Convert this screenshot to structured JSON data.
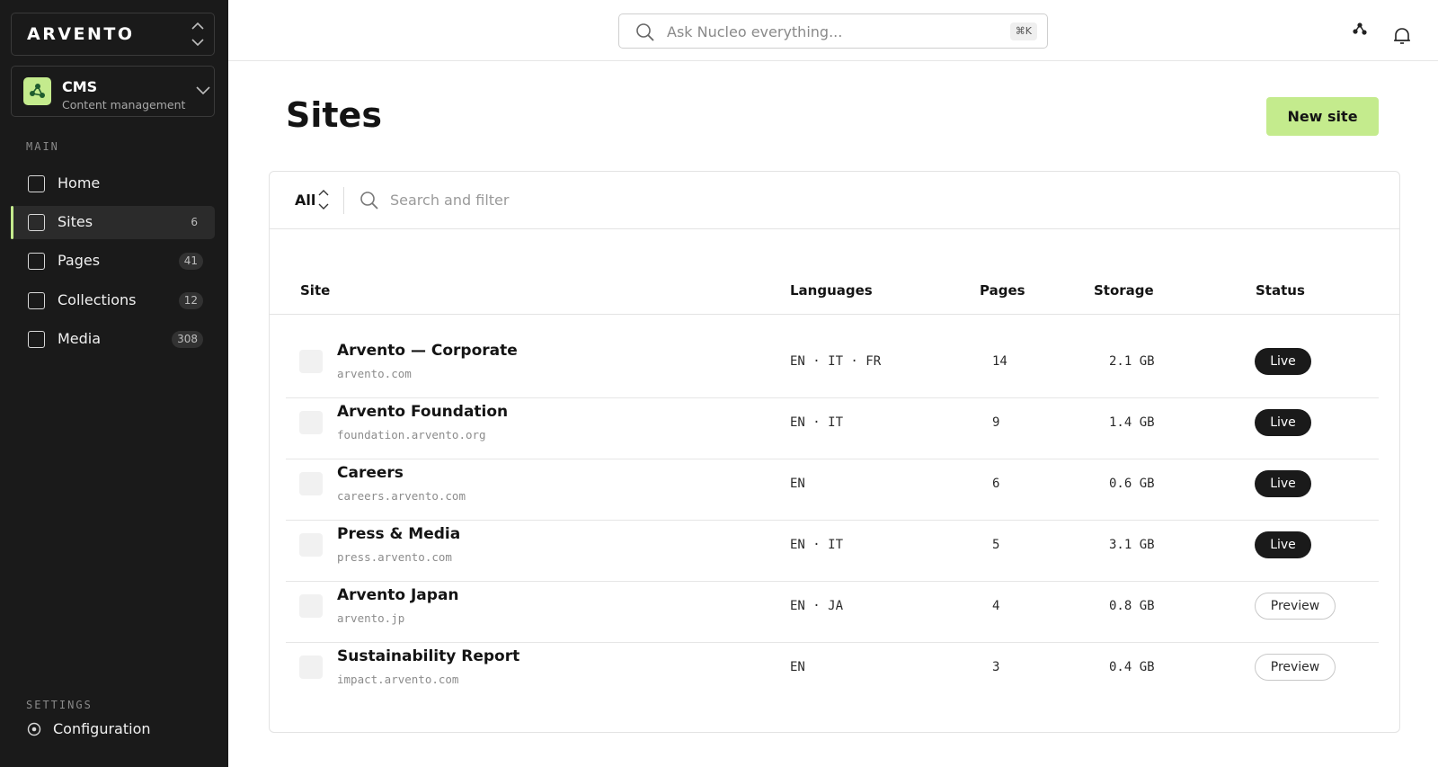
{
  "brand": {
    "name": "ARVENTO"
  },
  "workspace": {
    "title": "CMS",
    "subtitle": "Content management",
    "accent": "#c4eb8d"
  },
  "sidebar": {
    "section_main": "MAIN",
    "items": [
      {
        "label": "Home",
        "count": null
      },
      {
        "label": "Sites",
        "count": "6"
      },
      {
        "label": "Pages",
        "count": "41"
      },
      {
        "label": "Collections",
        "count": "12"
      },
      {
        "label": "Media",
        "count": "308"
      }
    ],
    "active_item": "Sites",
    "section_settings": "SETTINGS",
    "config_label": "Configuration"
  },
  "topbar": {
    "search_placeholder": "Ask Nucleo everything...",
    "search_shortcut": "⌘K",
    "icons": [
      "integrations-icon",
      "bell-icon"
    ]
  },
  "main": {
    "title": "Sites",
    "new_button": "New site",
    "filter": {
      "selected": "All",
      "search_placeholder": "Search and filter"
    },
    "columns": [
      "Site",
      "Languages",
      "Pages",
      "Storage",
      "Status"
    ],
    "rows": [
      {
        "name": "Arvento — Corporate",
        "domain": "arvento.com",
        "languages": "EN · IT · FR",
        "pages": "14",
        "storage": "2.1 GB",
        "status": "Live"
      },
      {
        "name": "Arvento Foundation",
        "domain": "foundation.arvento.org",
        "languages": "EN · IT",
        "pages": "9",
        "storage": "1.4 GB",
        "status": "Live"
      },
      {
        "name": "Careers",
        "domain": "careers.arvento.com",
        "languages": "EN",
        "pages": "6",
        "storage": "0.6 GB",
        "status": "Live"
      },
      {
        "name": "Press & Media",
        "domain": "press.arvento.com",
        "languages": "EN · IT",
        "pages": "5",
        "storage": "3.1 GB",
        "status": "Live"
      },
      {
        "name": "Arvento Japan",
        "domain": "arvento.jp",
        "languages": "EN · JA",
        "pages": "4",
        "storage": "0.8 GB",
        "status": "Preview"
      },
      {
        "name": "Sustainability Report",
        "domain": "impact.arvento.com",
        "languages": "EN",
        "pages": "3",
        "storage": "0.4 GB",
        "status": "Preview"
      }
    ]
  }
}
